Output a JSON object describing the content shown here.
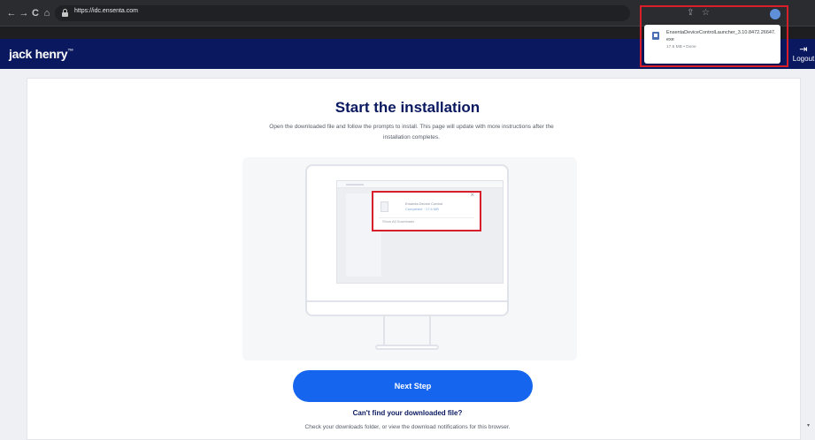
{
  "browser": {
    "url": "https://idc.ensenta.com",
    "back_icon": "←",
    "forward_icon": "→",
    "reload_icon": "C",
    "home_icon": "⌂",
    "share_icon": "⇪",
    "star_icon": "☆"
  },
  "download_popup": {
    "file_name": "EnsentaDeviceControlLauncher_3.10.8472.26647.exe",
    "status": "17.6 MB • Done"
  },
  "header": {
    "logo": "jack henry",
    "logo_mark": "™",
    "logout_icon": "⇥",
    "logout_label": "Logout"
  },
  "main": {
    "title": "Start the installation",
    "description": "Open the downloaded file and follow the prompts to install. This page will update with more instructions after the installation completes.",
    "illustration": {
      "file_name": "Ensenta Device Control",
      "status": "Completed · 17.6 MB",
      "show_all": "Show All Downloads",
      "close": "×"
    },
    "next_button": "Next Step",
    "help_title": "Can't find your downloaded file?",
    "help_text": "Check your downloads folder, or view the download notifications for this browser."
  },
  "colors": {
    "header_bg": "#0a1860",
    "accent_blue": "#1565ef",
    "highlight_red": "#d81e2a"
  }
}
